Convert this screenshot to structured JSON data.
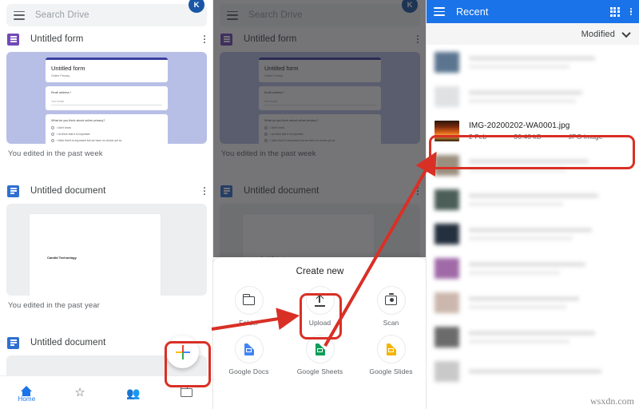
{
  "panel1": {
    "search": {
      "placeholder": "Search Drive",
      "avatar_initial": "K"
    },
    "cards": [
      {
        "name": "Untitled form",
        "icon": "google-forms-icon",
        "edited": "You edited in the past week",
        "preview": {
          "title": "Untitled form",
          "subtitle": "Online Privacy",
          "field_label": "Email address *",
          "field_placeholder": "Your email",
          "question": "What do you think about online privacy?",
          "options": [
            "I don't know",
            "I do think that it is important",
            "I think that it is important but we have no choice yet so"
          ]
        }
      },
      {
        "name": "Untitled document",
        "icon": "google-docs-icon",
        "edited": "You edited in the past year",
        "preview": {
          "body": "Candid Technology"
        }
      },
      {
        "name": "Untitled document",
        "icon": "google-docs-icon",
        "edited": "",
        "preview": {
          "body": ""
        }
      }
    ],
    "bottom_nav": [
      {
        "label": "Home",
        "icon": "home-icon",
        "active": true
      },
      {
        "label": "",
        "icon": "star-icon",
        "active": false
      },
      {
        "label": "",
        "icon": "shared-people-icon",
        "active": false
      },
      {
        "label": "",
        "icon": "folder-icon",
        "active": false
      }
    ],
    "fab": {
      "label": "+",
      "icon": "plus-icon"
    }
  },
  "panel2": {
    "sheet": {
      "title": "Create new",
      "items": [
        {
          "label": "Folder",
          "icon": "folder-icon"
        },
        {
          "label": "Upload",
          "icon": "upload-icon"
        },
        {
          "label": "Scan",
          "icon": "scan-camera-icon"
        },
        {
          "label": "Google Docs",
          "icon": "google-docs-icon"
        },
        {
          "label": "Google Sheets",
          "icon": "google-sheets-icon"
        },
        {
          "label": "Google Slides",
          "icon": "google-slides-icon"
        }
      ]
    }
  },
  "panel3": {
    "header": {
      "title": "Recent",
      "menu_icon": "hamburger-icon",
      "grid_icon": "grid-view-icon",
      "overflow_icon": "more-vertical-icon"
    },
    "sort": {
      "label": "Modified",
      "icon": "chevron-down-icon"
    },
    "highlighted_file": {
      "name": "IMG-20200202-WA0001.jpg",
      "date": "2 Feb",
      "size": "30.48 kB",
      "type": "JPG image",
      "thumb_color": "#d2501e"
    },
    "blurred_rows": [
      {
        "thumb_color": "#5b7590"
      },
      {
        "thumb_color": "#d8dadd"
      },
      {
        "thumb_color": "#9b8f7f"
      },
      {
        "thumb_color": "#4b5e57"
      },
      {
        "thumb_color": "#24303e"
      },
      {
        "thumb_color": "#a06aa8"
      },
      {
        "thumb_color": "#cbb7ad"
      },
      {
        "thumb_color": "#5e5e5e"
      },
      {
        "thumb_color": "#bdbdbd"
      }
    ]
  },
  "annotations": {
    "highlight_color": "#d93025",
    "boxes": [
      "fab-plus-button",
      "upload-option",
      "uploaded-file-row"
    ],
    "arrows": [
      "fab-to-upload",
      "upload-to-file"
    ]
  },
  "watermark": "wsxdn.com"
}
